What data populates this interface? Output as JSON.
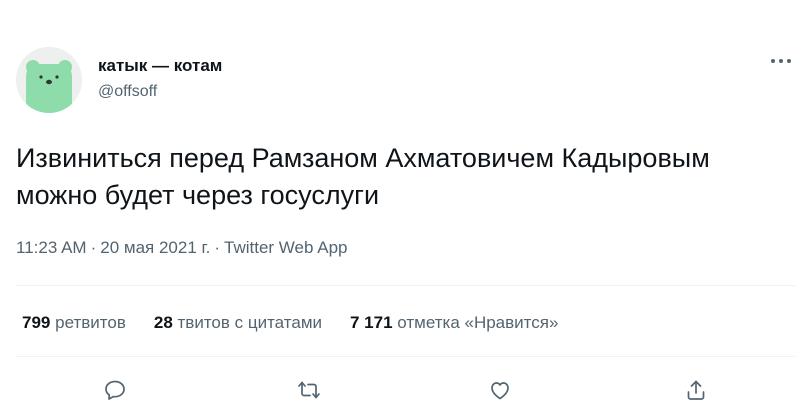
{
  "author": {
    "display_name": "катык — котам",
    "handle": "@offsoff"
  },
  "tweet": {
    "text": "Извиниться перед Рамзаном Ахматовичем Кадыровым можно будет через госуслуги",
    "time": "11:23 AM",
    "date": "20 мая 2021 г.",
    "source": "Twitter Web App"
  },
  "stats": {
    "retweets_count": "799",
    "retweets_label": "ретвитов",
    "quotes_count": "28",
    "quotes_label": "твитов с цитатами",
    "likes_count": "7 171",
    "likes_label": "отметка «Нравится»"
  },
  "icons": {
    "more": "more-icon",
    "reply": "reply-icon",
    "retweet": "retweet-icon",
    "like": "like-icon",
    "share": "share-icon"
  },
  "colors": {
    "text_primary": "#0f1419",
    "text_secondary": "#536471",
    "divider": "#eff3f4",
    "avatar_bear": "#8fdcab"
  }
}
